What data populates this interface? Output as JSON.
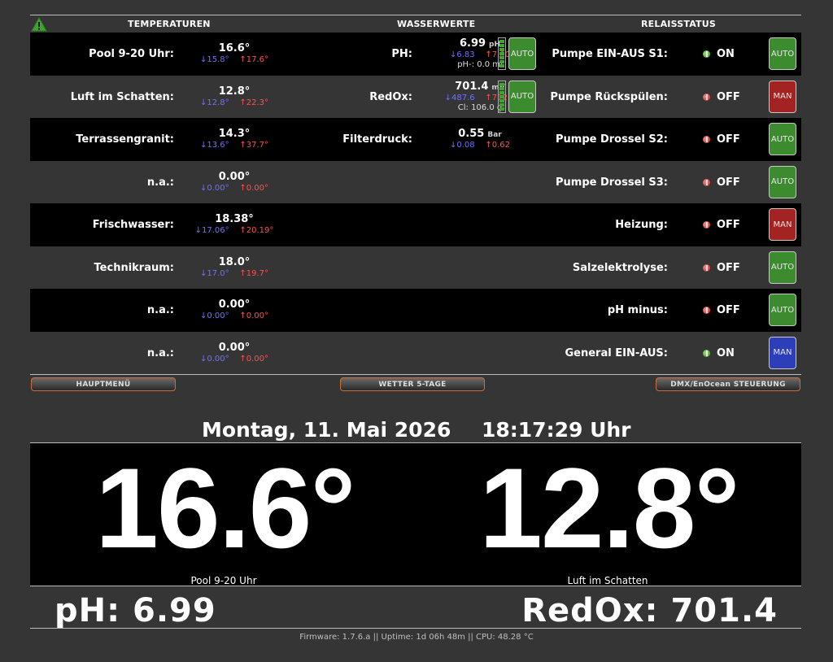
{
  "headers": {
    "temperaturen": "TEMPERATUREN",
    "wasserwerte": "WASSERWERTE",
    "relaisstatus": "RELAISSTATUS"
  },
  "temps": [
    {
      "label": "Pool 9-20 Uhr:",
      "value": "16.6°",
      "min": "↓15.8°",
      "max": "↑17.6°"
    },
    {
      "label": "Luft im Schatten:",
      "value": "12.8°",
      "min": "↓12.8°",
      "max": "↑22.3°"
    },
    {
      "label": "Terrassengranit:",
      "value": "14.3°",
      "min": "↓13.6°",
      "max": "↑37.7°"
    },
    {
      "label": "n.a.:",
      "value": "0.00°",
      "min": "↓0.00°",
      "max": "↑0.00°"
    },
    {
      "label": "Frischwasser:",
      "value": "18.38°",
      "min": "↓17.06°",
      "max": "↑20.19°"
    },
    {
      "label": "Technikraum:",
      "value": "18.0°",
      "min": "↓17.0°",
      "max": "↑19.7°"
    },
    {
      "label": "n.a.:",
      "value": "0.00°",
      "min": "↓0.00°",
      "max": "↑0.00°"
    },
    {
      "label": "n.a.:",
      "value": "0.00°",
      "min": "↓0.00°",
      "max": "↑0.00°"
    }
  ],
  "water": {
    "ph": {
      "label": "PH:",
      "value": "6.99",
      "unit": "pH",
      "min": "↓6.83",
      "max": "↑7.00",
      "extra": "pH-: 0.0 ml",
      "button": "AUTO"
    },
    "redox": {
      "label": "RedOx:",
      "value": "701.4",
      "unit": "mV",
      "min": "↓487.6",
      "max": "↑712.3",
      "extra": "Cl: 106.0 g",
      "button": "AUTO"
    },
    "filter": {
      "label": "Filterdruck:",
      "value": "0.55",
      "unit": "Bar",
      "min": "↓0.08",
      "max": "↑0.62"
    }
  },
  "relays": [
    {
      "label": "Pumpe EIN-AUS S1:",
      "state": "ON",
      "mode": "AUTO",
      "color": "#3d8b2f"
    },
    {
      "label": "Pumpe Rückspülen:",
      "state": "OFF",
      "mode": "MAN",
      "color": "#a32222"
    },
    {
      "label": "Pumpe Drossel S2:",
      "state": "OFF",
      "mode": "AUTO",
      "color": "#3d8b2f"
    },
    {
      "label": "Pumpe Drossel S3:",
      "state": "OFF",
      "mode": "AUTO",
      "color": "#3d8b2f"
    },
    {
      "label": "Heizung:",
      "state": "OFF",
      "mode": "MAN",
      "color": "#a32222"
    },
    {
      "label": "Salzelektrolyse:",
      "state": "OFF",
      "mode": "AUTO",
      "color": "#3d8b2f"
    },
    {
      "label": "pH minus:",
      "state": "OFF",
      "mode": "AUTO",
      "color": "#3d8b2f"
    },
    {
      "label": "General EIN-AUS:",
      "state": "ON",
      "mode": "MAN",
      "color": "#2c3fb8"
    }
  ],
  "nav": {
    "main_menu": "HAUPTMENÜ",
    "weather": "WETTER 5-TAGE",
    "dmx": "DMX/EnOcean STEUERUNG"
  },
  "date": "Montag, 11. Mai 2026",
  "time": "18:17:29 Uhr",
  "big": {
    "left_value": "16.6°",
    "left_caption": "Pool 9-20 Uhr",
    "right_value": "12.8°",
    "right_caption": "Luft im Schatten"
  },
  "bottom": {
    "ph": "pH:  6.99",
    "redox": "RedOx:  701.4"
  },
  "footer": "Firmware: 1.7.6.a   ||   Uptime: 1d 06h 48m   ||   CPU: 48.28 °C"
}
